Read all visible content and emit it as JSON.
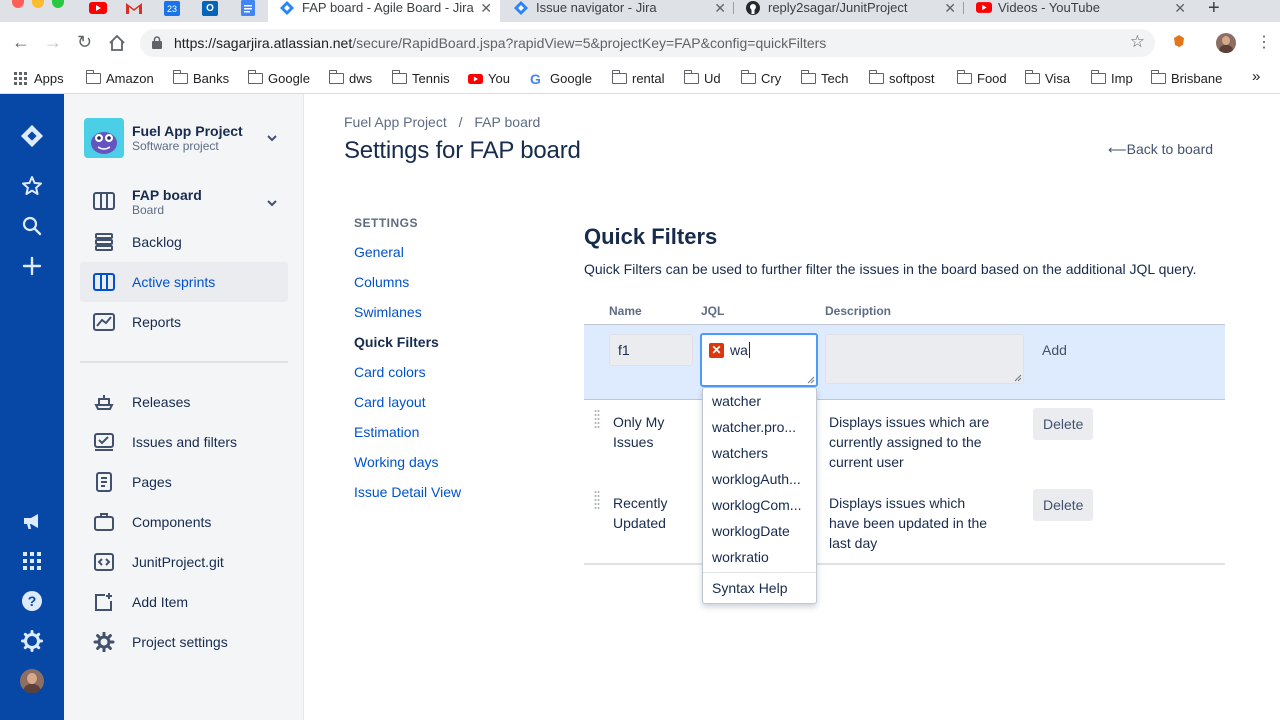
{
  "browser": {
    "tabs": [
      {
        "title": "FAP board - Agile Board - Jira",
        "active": true
      },
      {
        "title": "Issue navigator - Jira",
        "active": false
      },
      {
        "title": "reply2sagar/JunitProject",
        "active": false
      },
      {
        "title": "Videos - YouTube",
        "active": false
      }
    ],
    "pinned_tab_date": "23",
    "url_host": "https://sagarjira.atlassian.net",
    "url_path": "/secure/RapidBoard.jspa?rapidView=5&projectKey=FAP&config=quickFilters",
    "bookmarks": [
      "Apps",
      "Amazon",
      "Banks",
      "Google",
      "dws",
      "Tennis",
      "You",
      "Google",
      "rental",
      "Ud",
      "Cry",
      "Tech",
      "softpost",
      "Food",
      "Visa",
      "Imp",
      "Brisbane"
    ],
    "bookmarks_overflow": "»"
  },
  "project": {
    "name": "Fuel App Project",
    "type": "Software project"
  },
  "board": {
    "name": "FAP board",
    "sub": "Board"
  },
  "sidebar": {
    "items": [
      {
        "label": "Backlog"
      },
      {
        "label": "Active sprints"
      },
      {
        "label": "Reports"
      },
      {
        "label": "Releases"
      },
      {
        "label": "Issues and filters"
      },
      {
        "label": "Pages"
      },
      {
        "label": "Components"
      },
      {
        "label": "JunitProject.git"
      },
      {
        "label": "Add Item"
      },
      {
        "label": "Project settings"
      }
    ]
  },
  "breadcrumb": {
    "project": "Fuel App Project",
    "separator": "/",
    "board": "FAP board"
  },
  "page": {
    "title": "Settings for FAP board",
    "back_link": "Back to board"
  },
  "settings_menu": {
    "heading": "SETTINGS",
    "items": [
      "General",
      "Columns",
      "Swimlanes",
      "Quick Filters",
      "Card colors",
      "Card layout",
      "Estimation",
      "Working days",
      "Issue Detail View"
    ]
  },
  "quick_filters": {
    "title": "Quick Filters",
    "description": "Quick Filters can be used to further filter the issues in the board based on the additional JQL query.",
    "columns": {
      "name": "Name",
      "jql": "JQL",
      "description": "Description"
    },
    "new_filter": {
      "name_value": "f1",
      "jql_value": "wa",
      "description_value": "",
      "add_label": "Add"
    },
    "rows": [
      {
        "name_line1": "Only My",
        "name_line2": "Issues",
        "desc_line1": "Displays issues which are",
        "desc_line2": "currently assigned to the",
        "desc_line3": "current user",
        "delete_label": "Delete"
      },
      {
        "name_line1": "Recently",
        "name_line2": "Updated",
        "desc_line1": "Displays issues which",
        "desc_line2": "have been updated in the",
        "desc_line3": "last day",
        "delete_label": "Delete"
      }
    ],
    "suggestions": [
      "watcher",
      "watcher.pro...",
      "watchers",
      "worklogAuth...",
      "worklogCom...",
      "worklogDate",
      "workratio"
    ],
    "syntax_help": "Syntax Help"
  },
  "colors": {
    "global_nav": "#0747a6",
    "link": "#0052cc",
    "add_row_bg": "#deebff",
    "focus_border": "#4c9aff",
    "error": "#de350b"
  }
}
